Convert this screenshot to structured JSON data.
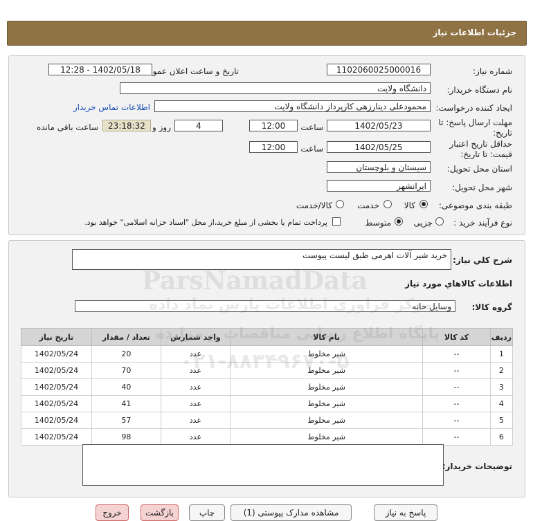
{
  "header": {
    "title": "جزئیات اطلاعات نیاز"
  },
  "form": {
    "need_number_label": "شماره نیاز:",
    "need_number": "1102060025000016",
    "announce_label": "تاریخ و ساعت اعلان عمومی:",
    "announce_value": "1402/05/18 - 12:28",
    "buyer_org_label": "نام دستگاه خریدار:",
    "buyer_org": "دانشگاه ولایت",
    "requester_label": "ایجاد کننده درخواست:",
    "requester": "محمودعلی دینارزهی کارپرداز دانشگاه ولایت",
    "contact_link": "اطلاعات تماس خریدار",
    "deadline_label_1": "مهلت ارسال پاسخ: تا",
    "deadline_label_2": "تاریخ:",
    "deadline_date": "1402/05/23",
    "time_label": "ساعت",
    "deadline_time": "12:00",
    "days_value": "4",
    "days_label": "روز و",
    "remaining_time": "23:18:32",
    "remaining_label": "ساعت باقی مانده",
    "validity_label_1": "حداقل تاریخ اعتبار",
    "validity_label_2": "قیمت: تا تاریخ:",
    "validity_date": "1402/05/25",
    "validity_time": "12:00",
    "province_label": "استان محل تحویل:",
    "province": "سیستان و بلوچستان",
    "city_label": "شهر محل تحویل:",
    "city": "ایرانشهر",
    "category_label": "طبقه بندی موضوعی:",
    "category_options": [
      "کالا",
      "خدمت",
      "کالا/خدمت"
    ],
    "category_selected": "کالا",
    "process_label": "نوع فرآیند خرید :",
    "process_options": [
      "جزیی",
      "متوسط"
    ],
    "process_selected": "متوسط",
    "payment_note": "پرداخت تمام یا بخشی از مبلغ خرید،از محل \"اسناد خزانه اسلامی\" خواهد بود."
  },
  "summary": {
    "title_label": "شرح کلي نياز:",
    "title_value": "خرید شیر آلات اهرمی طبق لیست پیوست",
    "items_heading": "اطلاعات کالاهاي مورد نياز",
    "group_label": "گروه کالا:",
    "group_value": "وسایل خانه"
  },
  "table": {
    "columns": [
      "ردیف",
      "کد کالا",
      "نام کالا",
      "واحد شمارش",
      "تعداد / مقدار",
      "تاریخ نیاز"
    ],
    "rows": [
      [
        "1",
        "--",
        "شیر مخلوط",
        "عدد",
        "20",
        "1402/05/24"
      ],
      [
        "2",
        "--",
        "شیر مخلوط",
        "عدد",
        "70",
        "1402/05/24"
      ],
      [
        "3",
        "--",
        "شیر مخلوط",
        "عدد",
        "40",
        "1402/05/24"
      ],
      [
        "4",
        "--",
        "شیر مخلوط",
        "عدد",
        "41",
        "1402/05/24"
      ],
      [
        "5",
        "--",
        "شیر مخلوط",
        "عدد",
        "57",
        "1402/05/24"
      ],
      [
        "6",
        "--",
        "شیر مخلوط",
        "عدد",
        "98",
        "1402/05/24"
      ]
    ]
  },
  "notes": {
    "label": "توضیحات خریدار:",
    "value": ""
  },
  "buttons": {
    "reply": "پاسخ به نیاز",
    "attachments": "مشاهده مدارک پیوستی (1)",
    "print": "چاپ",
    "back": "بازگشت",
    "exit": "خروج"
  },
  "watermark": {
    "brand": "ParsNamadData",
    "line1": "مرکز فراوری اطلاعات پارس نماد داده",
    "line2": "پایگاه اطلاع رسانی مناقصات و مزایده",
    "phone": "۰۲۱-۸۸۳۴۹۶۷۰-۵"
  }
}
